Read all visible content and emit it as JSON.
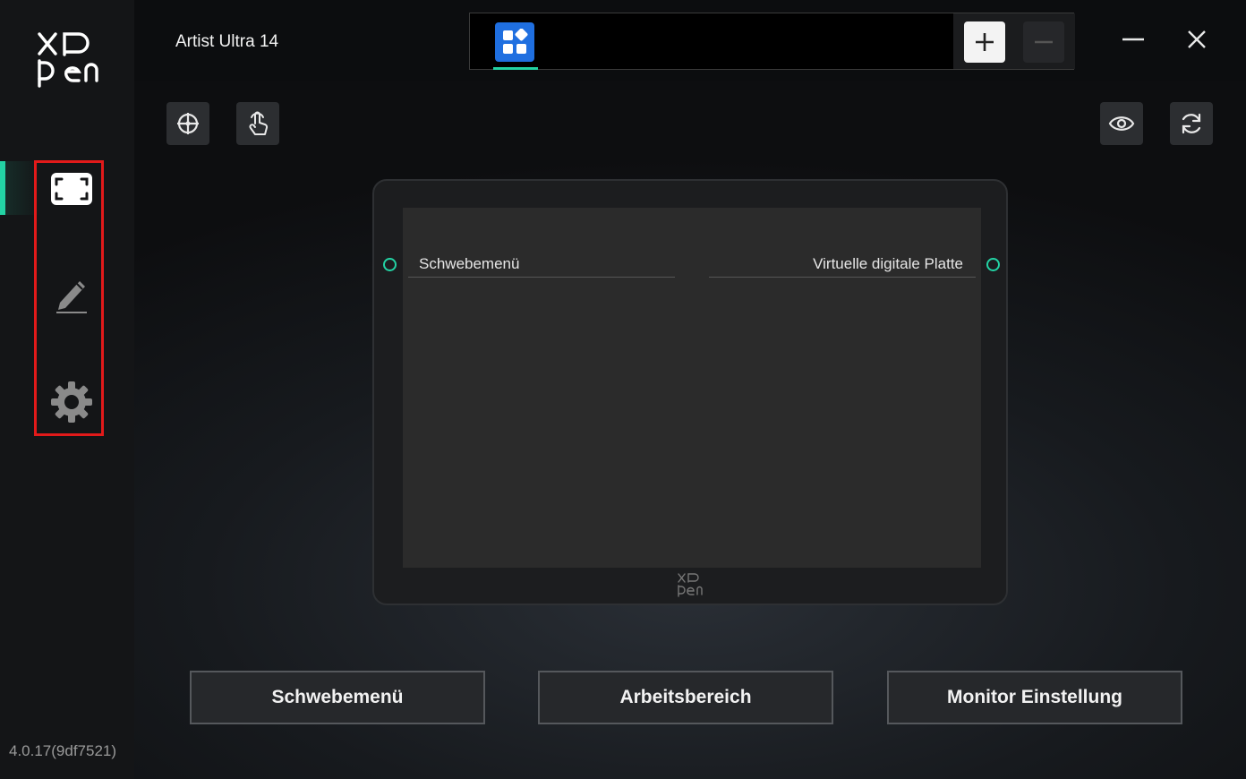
{
  "app": {
    "version": "4.0.17(9df7521)",
    "device_name": "Artist Ultra 14"
  },
  "sidebar": {
    "items": [
      {
        "name": "display-mapping",
        "icon": "screen-corners-icon",
        "active": true
      },
      {
        "name": "pen",
        "icon": "pen-icon",
        "active": false
      },
      {
        "name": "settings",
        "icon": "gear-icon",
        "active": false
      }
    ]
  },
  "tabs": {
    "app_tab_icon": "app-grid-icon",
    "add_icon": "plus-icon",
    "remove_icon": "minus-icon"
  },
  "window_controls": {
    "minimize_icon": "minimize-icon",
    "close_icon": "close-icon"
  },
  "toolbar": {
    "left": [
      "crosshair-icon",
      "touch-hand-icon"
    ],
    "right": [
      "eye-icon",
      "refresh-icon"
    ]
  },
  "tablet": {
    "left_label": "Schwebemenü",
    "right_label": "Virtuelle digitale Platte"
  },
  "buttons": {
    "float_menu": "Schwebemenü",
    "work_area": "Arbeitsbereich",
    "monitor_settings": "Monitor Einstellung"
  },
  "colors": {
    "accent": "#23d3a4",
    "app_tab": "#1f6fe0",
    "highlight_outline": "#e21a1a"
  }
}
